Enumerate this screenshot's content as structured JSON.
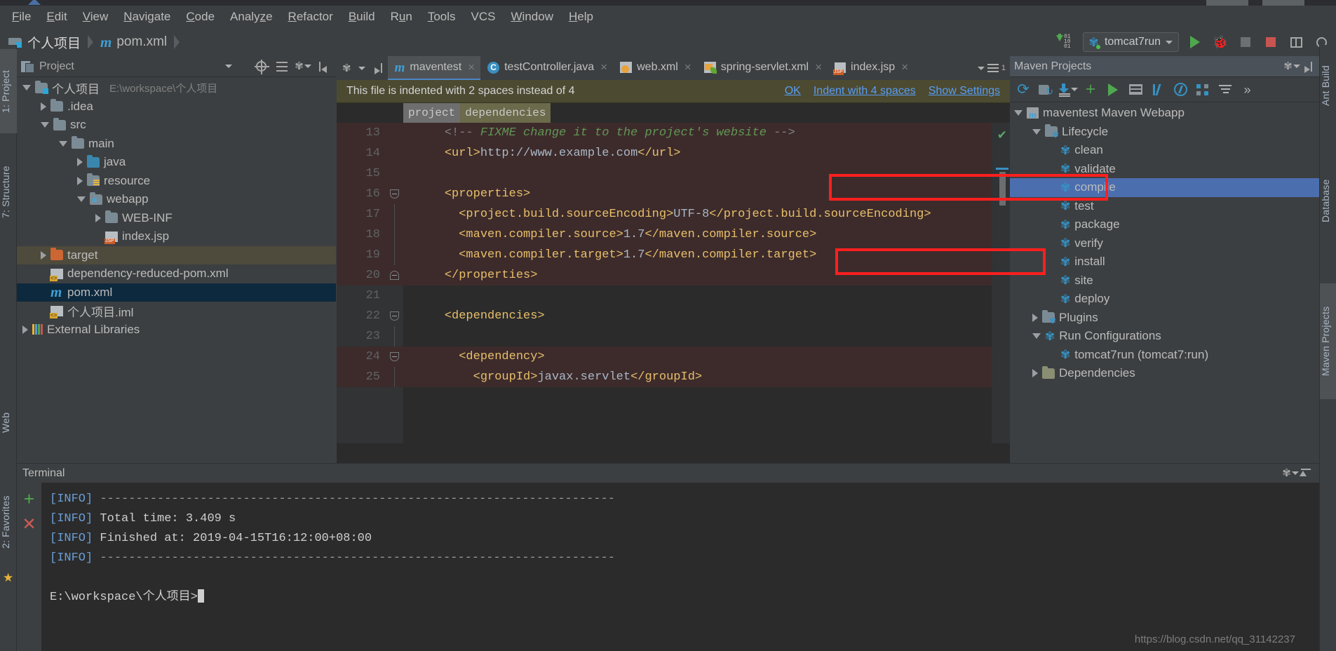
{
  "menubar": {
    "items": [
      {
        "label": "File",
        "mnemonic": "F"
      },
      {
        "label": "Edit",
        "mnemonic": "E"
      },
      {
        "label": "View",
        "mnemonic": "V"
      },
      {
        "label": "Navigate",
        "mnemonic": "N"
      },
      {
        "label": "Code",
        "mnemonic": "C"
      },
      {
        "label": "Analyze",
        "mnemonic": "z"
      },
      {
        "label": "Refactor",
        "mnemonic": "R"
      },
      {
        "label": "Build",
        "mnemonic": "B"
      },
      {
        "label": "Run",
        "mnemonic": "u"
      },
      {
        "label": "Tools",
        "mnemonic": "T"
      },
      {
        "label": "VCS",
        "mnemonic": ""
      },
      {
        "label": "Window",
        "mnemonic": "W"
      },
      {
        "label": "Help",
        "mnemonic": "H"
      }
    ]
  },
  "navbar": {
    "project_name": "个人项目",
    "file_name": "pom.xml",
    "run_config": "tomcat7run"
  },
  "left_tool_strip": {
    "tabs": [
      "1: Project",
      "7: Structure",
      "2: Favorites"
    ],
    "web_tab": "Web"
  },
  "right_tool_strip": {
    "tabs": [
      "Ant Build",
      "Database",
      "Maven Projects"
    ]
  },
  "project_panel": {
    "title": "Project",
    "tree": [
      {
        "label": "个人项目",
        "sub": "E:\\workspace\\个人项目",
        "indent": 0,
        "arrow": "down",
        "icon": "folder-project",
        "state": "normal"
      },
      {
        "label": ".idea",
        "sub": "",
        "indent": 1,
        "arrow": "right",
        "icon": "folder",
        "state": "normal"
      },
      {
        "label": "src",
        "sub": "",
        "indent": 1,
        "arrow": "down",
        "icon": "folder",
        "state": "normal"
      },
      {
        "label": "main",
        "sub": "",
        "indent": 2,
        "arrow": "down",
        "icon": "folder",
        "state": "normal"
      },
      {
        "label": "java",
        "sub": "",
        "indent": 3,
        "arrow": "right",
        "icon": "folder-source",
        "state": "normal"
      },
      {
        "label": "resource",
        "sub": "",
        "indent": 3,
        "arrow": "right",
        "icon": "folder-resource",
        "state": "normal"
      },
      {
        "label": "webapp",
        "sub": "",
        "indent": 3,
        "arrow": "down",
        "icon": "folder-web",
        "state": "normal"
      },
      {
        "label": "WEB-INF",
        "sub": "",
        "indent": 4,
        "arrow": "right",
        "icon": "folder",
        "state": "normal"
      },
      {
        "label": "index.jsp",
        "sub": "",
        "indent": 4,
        "arrow": "none",
        "icon": "file-jsp",
        "state": "normal"
      },
      {
        "label": "target",
        "sub": "",
        "indent": 1,
        "arrow": "right",
        "icon": "folder-target",
        "state": "highlight-olive"
      },
      {
        "label": "dependency-reduced-pom.xml",
        "sub": "",
        "indent": 1,
        "arrow": "none",
        "icon": "file-xml",
        "state": "normal"
      },
      {
        "label": "pom.xml",
        "sub": "",
        "indent": 1,
        "arrow": "none",
        "icon": "file-maven",
        "state": "selected"
      },
      {
        "label": "个人项目.iml",
        "sub": "",
        "indent": 1,
        "arrow": "none",
        "icon": "file-iml",
        "state": "normal"
      },
      {
        "label": "External Libraries",
        "sub": "",
        "indent": 0,
        "arrow": "right",
        "icon": "libraries",
        "state": "normal"
      }
    ]
  },
  "editor": {
    "tabs": [
      {
        "label": "maventest",
        "icon": "maven-icon",
        "active": true
      },
      {
        "label": "testController.java",
        "icon": "class-icon",
        "active": false
      },
      {
        "label": "web.xml",
        "icon": "xml-web-icon",
        "active": false
      },
      {
        "label": "spring-servlet.xml",
        "icon": "xml-spring-icon",
        "active": false
      },
      {
        "label": "index.jsp",
        "icon": "jsp-icon",
        "active": false
      }
    ],
    "notification": {
      "message": "This file is indented with 2 spaces instead of 4",
      "actions": [
        "OK",
        "Indent with 4 spaces",
        "Show Settings"
      ]
    },
    "breadcrumbs": [
      "project",
      "dependencies"
    ],
    "lines": [
      {
        "no": "13",
        "fold": "none",
        "text": "    <!-- FIXME change it to the project's website -->",
        "kind": "comment",
        "highlight": true
      },
      {
        "no": "14",
        "fold": "none",
        "text": "    <url>http://www.example.com</url>",
        "kind": "xml",
        "highlight": true
      },
      {
        "no": "15",
        "fold": "none",
        "text": "",
        "kind": "xml",
        "highlight": true
      },
      {
        "no": "16",
        "fold": "down",
        "text": "    <properties>",
        "kind": "xml",
        "highlight": true
      },
      {
        "no": "17",
        "fold": "bar",
        "text": "      <project.build.sourceEncoding>UTF-8</project.build.sourceEncoding>",
        "kind": "xml",
        "highlight": true
      },
      {
        "no": "18",
        "fold": "bar",
        "text": "      <maven.compiler.source>1.7</maven.compiler.source>",
        "kind": "xml",
        "highlight": true
      },
      {
        "no": "19",
        "fold": "bar",
        "text": "      <maven.compiler.target>1.7</maven.compiler.target>",
        "kind": "xml",
        "highlight": true
      },
      {
        "no": "20",
        "fold": "up",
        "text": "    </properties>",
        "kind": "xml",
        "highlight": true
      },
      {
        "no": "21",
        "fold": "none",
        "text": "",
        "kind": "xml",
        "highlight": false
      },
      {
        "no": "22",
        "fold": "down",
        "text": "    <dependencies>",
        "kind": "xml",
        "highlight": false
      },
      {
        "no": "23",
        "fold": "bar",
        "text": "",
        "kind": "xml",
        "highlight": false
      },
      {
        "no": "24",
        "fold": "down",
        "text": "      <dependency>",
        "kind": "xml",
        "highlight": true
      },
      {
        "no": "25",
        "fold": "bar",
        "text": "        <groupId>javax.servlet</groupId>",
        "kind": "xml",
        "highlight": true
      }
    ]
  },
  "maven_panel": {
    "title": "Maven Projects",
    "tree": [
      {
        "label": "maventest Maven Webapp",
        "indent": 0,
        "arrow": "down",
        "icon": "maven-module-icon",
        "selected": false,
        "annotated": "none"
      },
      {
        "label": "Lifecycle",
        "indent": 1,
        "arrow": "down",
        "icon": "lifecycle-folder-icon",
        "selected": false,
        "annotated": "none"
      },
      {
        "label": "clean",
        "indent": 2,
        "arrow": "none",
        "icon": "goal-gear-icon",
        "selected": false,
        "annotated": "none"
      },
      {
        "label": "validate",
        "indent": 2,
        "arrow": "none",
        "icon": "goal-gear-icon",
        "selected": false,
        "annotated": "none"
      },
      {
        "label": "compile",
        "indent": 2,
        "arrow": "none",
        "icon": "goal-gear-icon",
        "selected": true,
        "annotated": "red-box"
      },
      {
        "label": "test",
        "indent": 2,
        "arrow": "none",
        "icon": "goal-gear-icon",
        "selected": false,
        "annotated": "none"
      },
      {
        "label": "package",
        "indent": 2,
        "arrow": "none",
        "icon": "goal-gear-icon",
        "selected": false,
        "annotated": "red-box"
      },
      {
        "label": "verify",
        "indent": 2,
        "arrow": "none",
        "icon": "goal-gear-icon",
        "selected": false,
        "annotated": "none"
      },
      {
        "label": "install",
        "indent": 2,
        "arrow": "none",
        "icon": "goal-gear-icon",
        "selected": false,
        "annotated": "none"
      },
      {
        "label": "site",
        "indent": 2,
        "arrow": "none",
        "icon": "goal-gear-icon",
        "selected": false,
        "annotated": "none"
      },
      {
        "label": "deploy",
        "indent": 2,
        "arrow": "none",
        "icon": "goal-gear-icon",
        "selected": false,
        "annotated": "none"
      },
      {
        "label": "Plugins",
        "indent": 1,
        "arrow": "right",
        "icon": "plugins-folder-icon",
        "selected": false,
        "annotated": "none"
      },
      {
        "label": "Run Configurations",
        "indent": 1,
        "arrow": "down",
        "icon": "run-config-gear-icon",
        "selected": false,
        "annotated": "none"
      },
      {
        "label": "tomcat7run (tomcat7:run)",
        "indent": 2,
        "arrow": "none",
        "icon": "goal-gear-icon",
        "selected": false,
        "annotated": "none"
      },
      {
        "label": "Dependencies",
        "indent": 1,
        "arrow": "right",
        "icon": "dependencies-folder-icon",
        "selected": false,
        "annotated": "none"
      }
    ]
  },
  "terminal": {
    "title": "Terminal",
    "lines": [
      {
        "prefix": "[INFO]",
        "text": " ------------------------------------------------------------------------"
      },
      {
        "prefix": "[INFO]",
        "text": " Total time: 3.409 s"
      },
      {
        "prefix": "[INFO]",
        "text": " Finished at: 2019-04-15T16:12:00+08:00"
      },
      {
        "prefix": "[INFO]",
        "text": " ------------------------------------------------------------------------"
      }
    ],
    "prompt": "E:\\workspace\\个人项目>"
  },
  "watermark": "https://blog.csdn.net/qq_31142237",
  "colors": {
    "accent_blue": "#4b6eaf",
    "annotation_red": "#ff1f1f",
    "notification_bg": "#4c4a31",
    "panel_bg": "#3c3f41",
    "editor_bg": "#2b2b2b"
  }
}
